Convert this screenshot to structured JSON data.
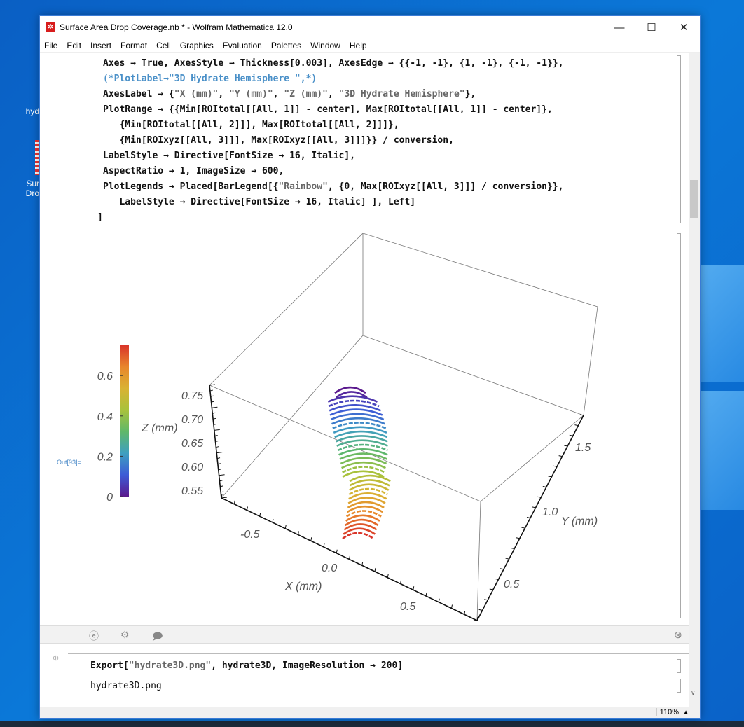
{
  "desktop": {
    "icons": [
      {
        "label": "hyd"
      },
      {
        "label": "Sur"
      },
      {
        "label": "Dro"
      }
    ]
  },
  "window": {
    "title": "Surface Area Drop Coverage.nb * - Wolfram Mathematica 12.0",
    "minimize": "—",
    "maximize": "☐",
    "close": "✕"
  },
  "menu": [
    "File",
    "Edit",
    "Insert",
    "Format",
    "Cell",
    "Graphics",
    "Evaluation",
    "Palettes",
    "Window",
    "Help"
  ],
  "code_lines": [
    [
      {
        "t": "Axes → True, AxesStyle → Thickness[0.003], AxesEdge → {{-1, -1}, {1, -1}, {-1, -1}},"
      }
    ],
    [
      {
        "t": "(*PlotLabel→\"3D Hydrate Hemisphere \",*)",
        "c": "cmt"
      }
    ],
    [
      {
        "t": "AxesLabel → {"
      },
      {
        "t": "\"X (mm)\"",
        "c": "str"
      },
      {
        "t": ", "
      },
      {
        "t": "\"Y (mm)\"",
        "c": "str"
      },
      {
        "t": ", "
      },
      {
        "t": "\"Z (mm)\"",
        "c": "str"
      },
      {
        "t": ", "
      },
      {
        "t": "\"3D Hydrate Hemisphere\"",
        "c": "str"
      },
      {
        "t": "},"
      }
    ],
    [
      {
        "t": "PlotRange → {{Min[ROItotal[[All, 1]] - center], Max[ROItotal[[All, 1]] - center]},"
      }
    ],
    [
      {
        "t": "   {Min[ROItotal[[All, 2]]], Max[ROItotal[[All, 2]]]},"
      }
    ],
    [
      {
        "t": "   {Min[ROIxyz[[All, 3]]], Max[ROIxyz[[All, 3]]]}} / conversion,"
      }
    ],
    [
      {
        "t": "LabelStyle → Directive[FontSize → 16, Italic],"
      }
    ],
    [
      {
        "t": "AspectRatio → 1, ImageSize → 600,"
      }
    ],
    [
      {
        "t": "PlotLegends → Placed[BarLegend[{"
      },
      {
        "t": "\"Rainbow\"",
        "c": "str"
      },
      {
        "t": ", {0, Max[ROIxyz[[All, 3]]] / conversion}},"
      }
    ],
    [
      {
        "t": "   LabelStyle → Directive[FontSize → 16, Italic] ], Left]"
      }
    ],
    [
      {
        "t": "]"
      }
    ]
  ],
  "output_label": "Out[93]=",
  "chart_data": {
    "type": "scatter3d",
    "axes": {
      "x": {
        "label": "X (mm)",
        "ticks": [
          "-0.5",
          "0.0",
          "0.5"
        ]
      },
      "y": {
        "label": "Y (mm)",
        "ticks": [
          "0.5",
          "1.0",
          "1.5"
        ]
      },
      "z": {
        "label": "Z (mm)",
        "ticks": [
          "0.55",
          "0.60",
          "0.65",
          "0.70",
          "0.75"
        ]
      }
    },
    "legend": {
      "type": "bar",
      "colormap": "Rainbow",
      "range": [
        0,
        0.75
      ],
      "ticks": [
        "0",
        "0.2",
        "0.4",
        "0.6"
      ],
      "placement": "left"
    },
    "colors": [
      "#5b1a8e",
      "#3d5bd6",
      "#3f9fc0",
      "#5fb86a",
      "#a8c23c",
      "#d9b233",
      "#e8862c",
      "#d9352a"
    ]
  },
  "toolbar": {
    "icons": [
      "wolfram-alpha-icon",
      "gear-icon",
      "comment-icon"
    ],
    "close": "⊗"
  },
  "cell2": {
    "prefix": "Export[",
    "string": "\"hydrate3D.png\"",
    "suffix": ", hydrate3D, ImageResolution → 200]",
    "output": "hydrate3D.png"
  },
  "status": {
    "zoom": "110%"
  }
}
